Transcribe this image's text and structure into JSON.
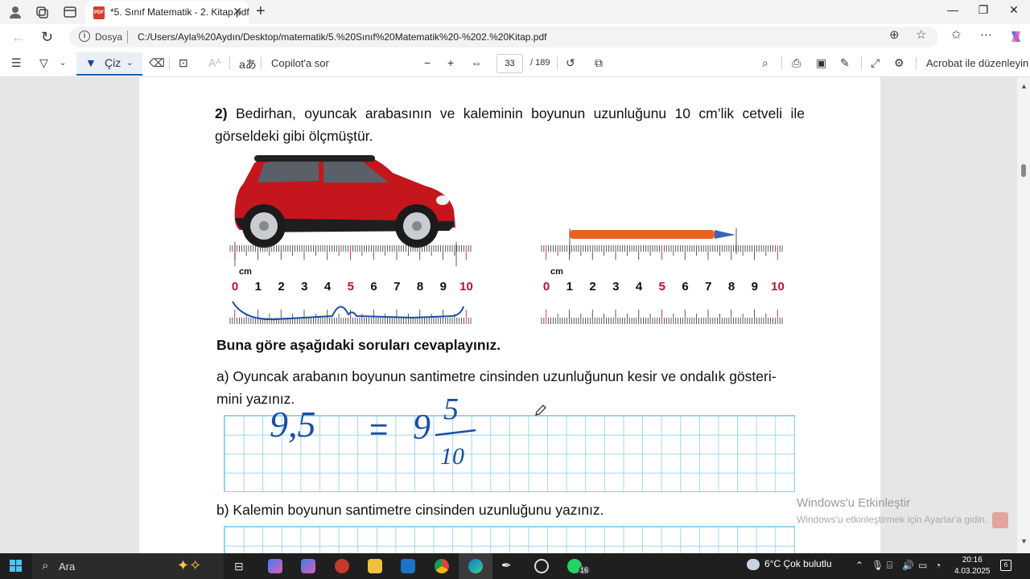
{
  "browser": {
    "tab_title": "*5. Sınıf Matematik - 2. Kitap.pdf",
    "address_label": "Dosya",
    "url": "C:/Users/Ayla%20Aydın/Desktop/matematik/5.%20Sınıf%20Matematik%20-%202.%20Kitap.pdf"
  },
  "pdf_toolbar": {
    "draw_label": "Çiz",
    "copilot_label": "Copilot'a sor",
    "current_page": "33",
    "total_pages": "/ 189",
    "edit_label": "Acrobat ile düzenleyin"
  },
  "document": {
    "question_number": "2)",
    "question_text": "Bedirhan, oyuncak arabasının ve kaleminin boyunun uzunluğunu 10 cm’lik cetveli ile görseldeki gibi ölçmüştür.",
    "ruler_unit": "cm",
    "ruler_numbers": [
      "0",
      "1",
      "2",
      "3",
      "4",
      "5",
      "6",
      "7",
      "8",
      "9",
      "10"
    ],
    "instruction": "Buna göre aşağıdaki soruları cevaplayınız.",
    "part_a": "a) Oyuncak arabanın boyunun santimetre cinsinden uzunluğunun kesir ve ondalık gösterimini yazınız.",
    "part_a_line1": "a) Oyuncak arabanın boyunun santimetre cinsinden uzunluğunun kesir ve ondalık gösteri-",
    "part_a_line2": "mini yazınız.",
    "handwriting": {
      "decimal": "9,5",
      "equals": "=",
      "whole": "9",
      "numerator": "5",
      "denominator": "10"
    },
    "part_b": "b) Kalemin boyunun santimetre cinsinden uzunluğunu yazınız."
  },
  "watermark": {
    "line1": "Windows'u Etkinleştir",
    "line2": "Windows'u etkinleştirmek için Ayarlar'a gidin."
  },
  "taskbar": {
    "search_label": "Ara",
    "weather": "6°C  Çok bulutlu",
    "time": "20:16",
    "date": "4.03.2025",
    "whatsapp_badge": "16",
    "notif_badge": "6"
  },
  "colors": {
    "ruler_red": "#c0102a",
    "ink_blue": "#1a4ea6",
    "grid_blue": "#9dd7ec",
    "car_red": "#c4161c",
    "pencil_orange": "#e8621e"
  }
}
